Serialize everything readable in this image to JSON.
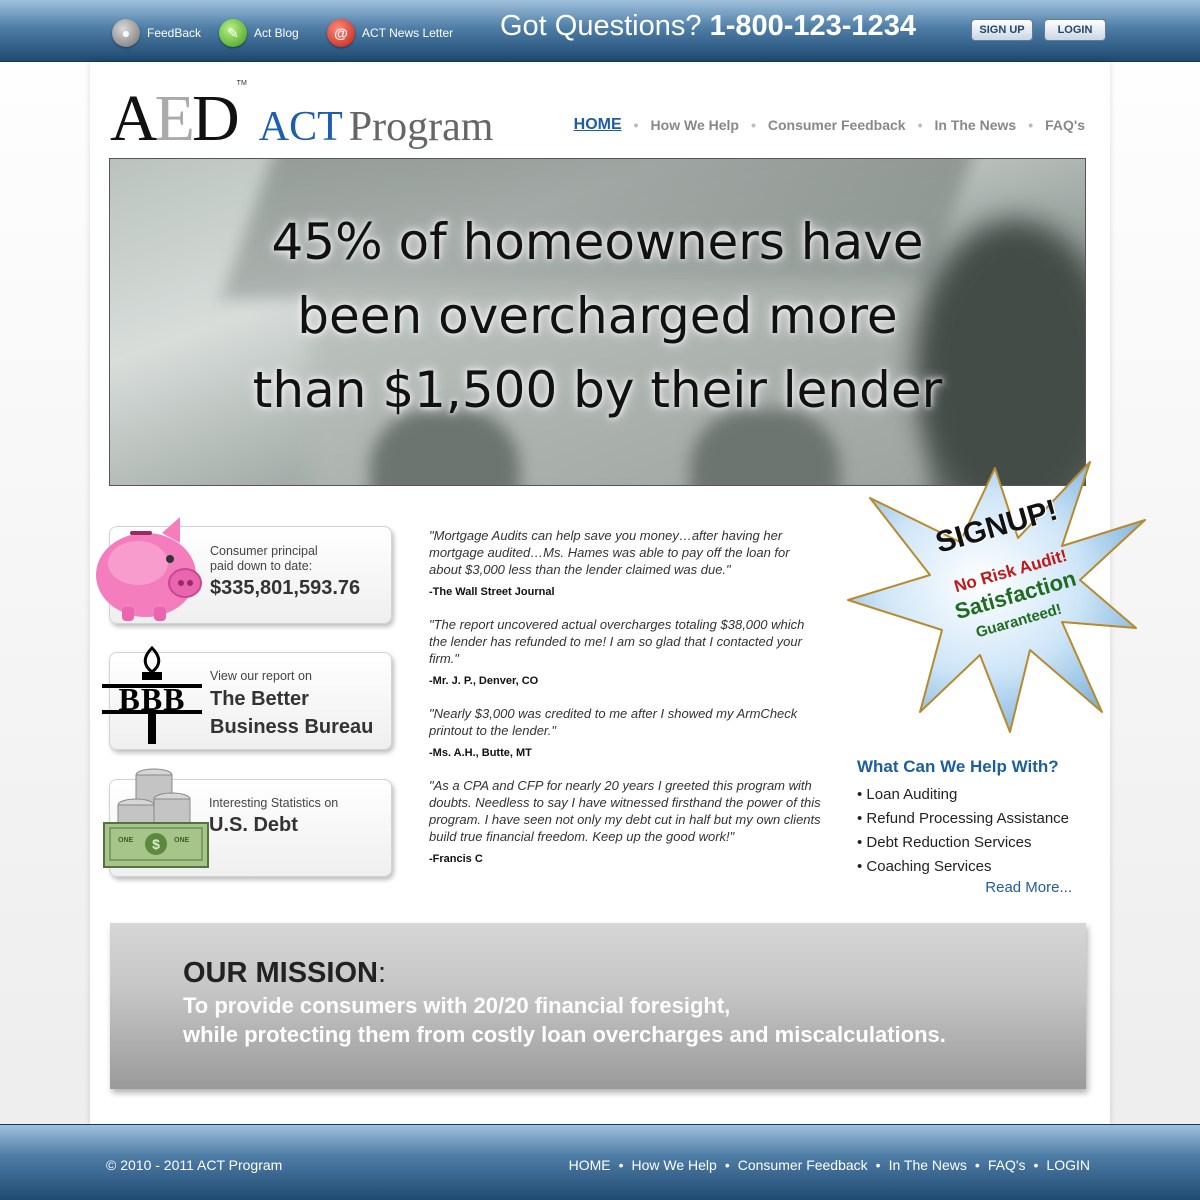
{
  "top_bar": {
    "links": [
      {
        "label": "FeedBack",
        "icon": "speech-bubble-icon"
      },
      {
        "label": "Act Blog",
        "icon": "pencil-icon"
      },
      {
        "label": "ACT News Letter",
        "icon": "at-sign-icon"
      }
    ],
    "questions_label": "Got Questions?",
    "phone": "1-800-123-1234",
    "signup_label": "SIGN UP",
    "login_label": "LOGIN"
  },
  "logo": {
    "aed_a": "A",
    "aed_e": "E",
    "aed_d": "D",
    "tm": "TM",
    "act": "ACT",
    "program": "Program"
  },
  "nav": {
    "home": "HOME",
    "how_we_help": "How We Help",
    "consumer_feedback": "Consumer Feedback",
    "in_the_news": "In The News",
    "faqs": "FAQ's",
    "separator": "•"
  },
  "hero": {
    "line1": "45% of homeowners have",
    "line2": "been overcharged more",
    "line3": "than $1,500 by their lender"
  },
  "signup_star": {
    "title": "SIGNUP!",
    "line1": "No Risk Audit!",
    "line2": "Satisfaction",
    "line3": "Guaranteed!"
  },
  "boxes": {
    "principal": {
      "line1": "Consumer principal",
      "line2": "paid down to date:",
      "amount": "$335,801,593.76"
    },
    "bbb": {
      "small": "View our report on",
      "line1": "The Better",
      "line2": "Business Bureau",
      "logo_text": "BBB"
    },
    "debt": {
      "small": "Interesting Statistics on",
      "big": "U.S. Debt",
      "bill_text": "ONE"
    }
  },
  "testimonials": [
    {
      "quote": "\"Mortgage Audits can help save you money…after having her mortgage audited…Ms. Hames was able to pay off the loan for about $3,000 less than the lender claimed was due.\"",
      "author": "-The Wall Street Journal"
    },
    {
      "quote": "\"The report uncovered actual overcharges totaling $38,000 which the lender has refunded to me! I am so glad that I contacted your firm.\"",
      "author": "-Mr. J. P., Denver, CO"
    },
    {
      "quote": "\"Nearly $3,000 was credited to me after I showed my ArmCheck printout to the lender.\"",
      "author": "-Ms. A.H., Butte, MT"
    },
    {
      "quote": "\"As a CPA and CFP for nearly 20 years I greeted this program with doubts. Needless to say I have witnessed firsthand the power of this program. I have seen not only my debt cut in half but my own clients build true financial freedom. Keep up the good work!\"",
      "author": "-Francis C"
    }
  ],
  "help": {
    "title": "What Can We Help With?",
    "items": [
      "• Loan Auditing",
      "• Refund Processing Assistance",
      "• Debt Reduction Services",
      "• Coaching Services"
    ],
    "read_more": "Read More..."
  },
  "mission": {
    "title": "OUR MISSION",
    "colon": ":",
    "line1": "To provide consumers with 20/20 financial foresight,",
    "line2": "while protecting them from costly loan overcharges and miscalculations."
  },
  "footer": {
    "copyright": "© 2010 - 2011 ACT Program",
    "links": [
      "HOME",
      "How We Help",
      "Consumer Feedback",
      "In The News",
      "FAQ's",
      "LOGIN"
    ],
    "separator": "•"
  },
  "colors": {
    "brand_blue": "#1d5e9e",
    "bar_blue": "#4f7ea6",
    "mission_gray": "#c6c6c6"
  }
}
